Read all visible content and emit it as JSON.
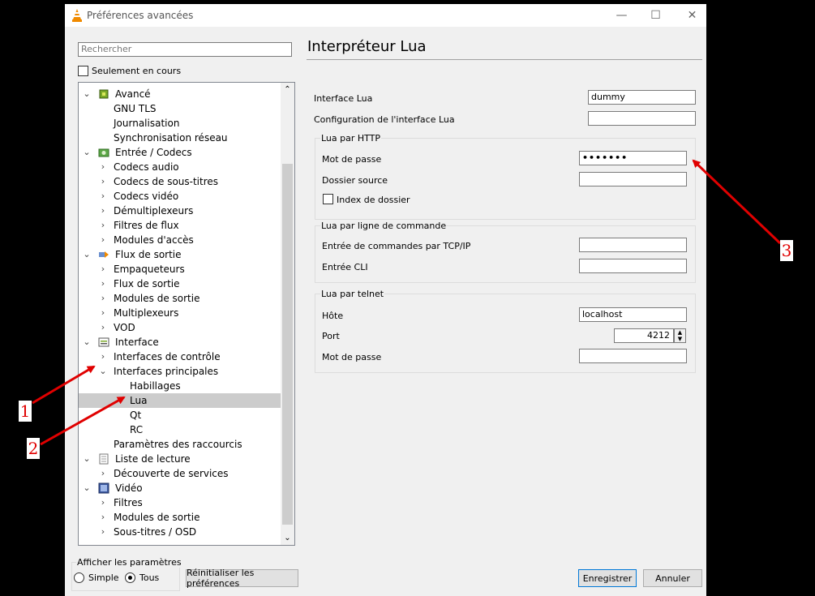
{
  "window": {
    "title": "Préférences avancées",
    "controls": {
      "minimize": "—",
      "maximize": "☐",
      "close": "✕"
    }
  },
  "sidebar": {
    "search_placeholder": "Rechercher",
    "only_current": "Seulement en cours",
    "tree": [
      {
        "label": "Avancé",
        "level": 0,
        "expanded": true,
        "icon": "chip-icon"
      },
      {
        "label": "GNU TLS",
        "level": 1
      },
      {
        "label": "Journalisation",
        "level": 1
      },
      {
        "label": "Synchronisation réseau",
        "level": 1
      },
      {
        "label": "Entrée / Codecs",
        "level": 0,
        "expanded": true,
        "icon": "input-codecs-icon"
      },
      {
        "label": "Codecs audio",
        "level": 1,
        "collapsed": true
      },
      {
        "label": "Codecs de sous-titres",
        "level": 1,
        "collapsed": true
      },
      {
        "label": "Codecs vidéo",
        "level": 1,
        "collapsed": true
      },
      {
        "label": "Démultiplexeurs",
        "level": 1,
        "collapsed": true
      },
      {
        "label": "Filtres de flux",
        "level": 1,
        "collapsed": true
      },
      {
        "label": "Modules d'accès",
        "level": 1,
        "collapsed": true
      },
      {
        "label": "Flux de sortie",
        "level": 0,
        "expanded": true,
        "icon": "stream-output-icon"
      },
      {
        "label": "Empaqueteurs",
        "level": 1,
        "collapsed": true
      },
      {
        "label": "Flux de sortie",
        "level": 1,
        "collapsed": true
      },
      {
        "label": "Modules de sortie",
        "level": 1,
        "collapsed": true
      },
      {
        "label": "Multiplexeurs",
        "level": 1,
        "collapsed": true
      },
      {
        "label": "VOD",
        "level": 1,
        "collapsed": true
      },
      {
        "label": "Interface",
        "level": 0,
        "expanded": true,
        "icon": "interface-icon"
      },
      {
        "label": "Interfaces de contrôle",
        "level": 1,
        "collapsed": true
      },
      {
        "label": "Interfaces principales",
        "level": 1,
        "expanded": true
      },
      {
        "label": "Habillages",
        "level": 2
      },
      {
        "label": "Lua",
        "level": 2,
        "selected": true
      },
      {
        "label": "Qt",
        "level": 2
      },
      {
        "label": "RC",
        "level": 2
      },
      {
        "label": "Paramètres des raccourcis",
        "level": 1
      },
      {
        "label": "Liste de lecture",
        "level": 0,
        "expanded": true,
        "icon": "playlist-icon"
      },
      {
        "label": "Découverte de services",
        "level": 1,
        "collapsed": true
      },
      {
        "label": "Vidéo",
        "level": 0,
        "expanded": true,
        "icon": "video-icon"
      },
      {
        "label": "Filtres",
        "level": 1,
        "collapsed": true
      },
      {
        "label": "Modules de sortie",
        "level": 1,
        "collapsed": true
      },
      {
        "label": "Sous-titres / OSD",
        "level": 1,
        "collapsed": true
      }
    ]
  },
  "main": {
    "title": "Interpréteur Lua",
    "lua_interface_label": "Interface Lua",
    "lua_interface_value": "dummy",
    "lua_config_label": "Configuration de l'interface Lua",
    "lua_config_value": "",
    "http": {
      "legend": "Lua par HTTP",
      "password_label": "Mot de passe",
      "password_value": "•••••••",
      "source_label": "Dossier source",
      "source_value": "",
      "index_label": "Index de dossier"
    },
    "cli": {
      "legend": "Lua par ligne de commande",
      "tcp_label": "Entrée de commandes par TCP/IP",
      "tcp_value": "",
      "cli_label": "Entrée CLI",
      "cli_value": ""
    },
    "telnet": {
      "legend": "Lua par telnet",
      "host_label": "Hôte",
      "host_value": "localhost",
      "port_label": "Port",
      "port_value": "4212",
      "password_label": "Mot de passe",
      "password_value": ""
    }
  },
  "footer": {
    "show_params": "Afficher les paramètres",
    "simple": "Simple",
    "all": "Tous",
    "reset": "Réinitialiser les préférences",
    "save": "Enregistrer",
    "cancel": "Annuler"
  },
  "annotations": {
    "one": "1",
    "two": "2",
    "three": "3"
  },
  "colors": {
    "annotation": "#e00000",
    "selection": "#cccccc",
    "accent": "#0078d7"
  }
}
